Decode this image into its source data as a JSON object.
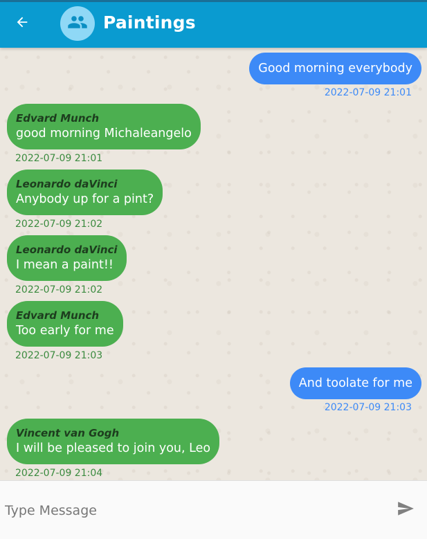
{
  "header": {
    "title": "Paintings",
    "back_icon": "arrow-back-icon",
    "avatar_icon": "group-icon",
    "bar_color": "#0a9bd0"
  },
  "messages": [
    {
      "direction": "out",
      "text": "Good morning everybody",
      "time": "2022-07-09 21:01"
    },
    {
      "direction": "in",
      "sender": "Edvard Munch",
      "text": "good morning Michaleangelo",
      "time": "2022-07-09 21:01"
    },
    {
      "direction": "in",
      "sender": "Leonardo daVinci",
      "text": "Anybody up for a pint?",
      "time": "2022-07-09 21:02"
    },
    {
      "direction": "in",
      "sender": "Leonardo daVinci",
      "text": "I mean a paint!!",
      "time": "2022-07-09 21:02"
    },
    {
      "direction": "in",
      "sender": "Edvard Munch",
      "text": "Too early for me",
      "time": "2022-07-09 21:03"
    },
    {
      "direction": "out",
      "text": "And toolate for me",
      "time": "2022-07-09 21:03"
    },
    {
      "direction": "in",
      "sender": "Vincent van Gogh",
      "text": "I will be pleased to join you, Leo",
      "time": "2022-07-09 21:04"
    }
  ],
  "composer": {
    "placeholder": "Type Message",
    "send_icon": "send-icon"
  },
  "colors": {
    "incoming_bubble": "#4caf50",
    "outgoing_bubble": "#3d8af7"
  }
}
